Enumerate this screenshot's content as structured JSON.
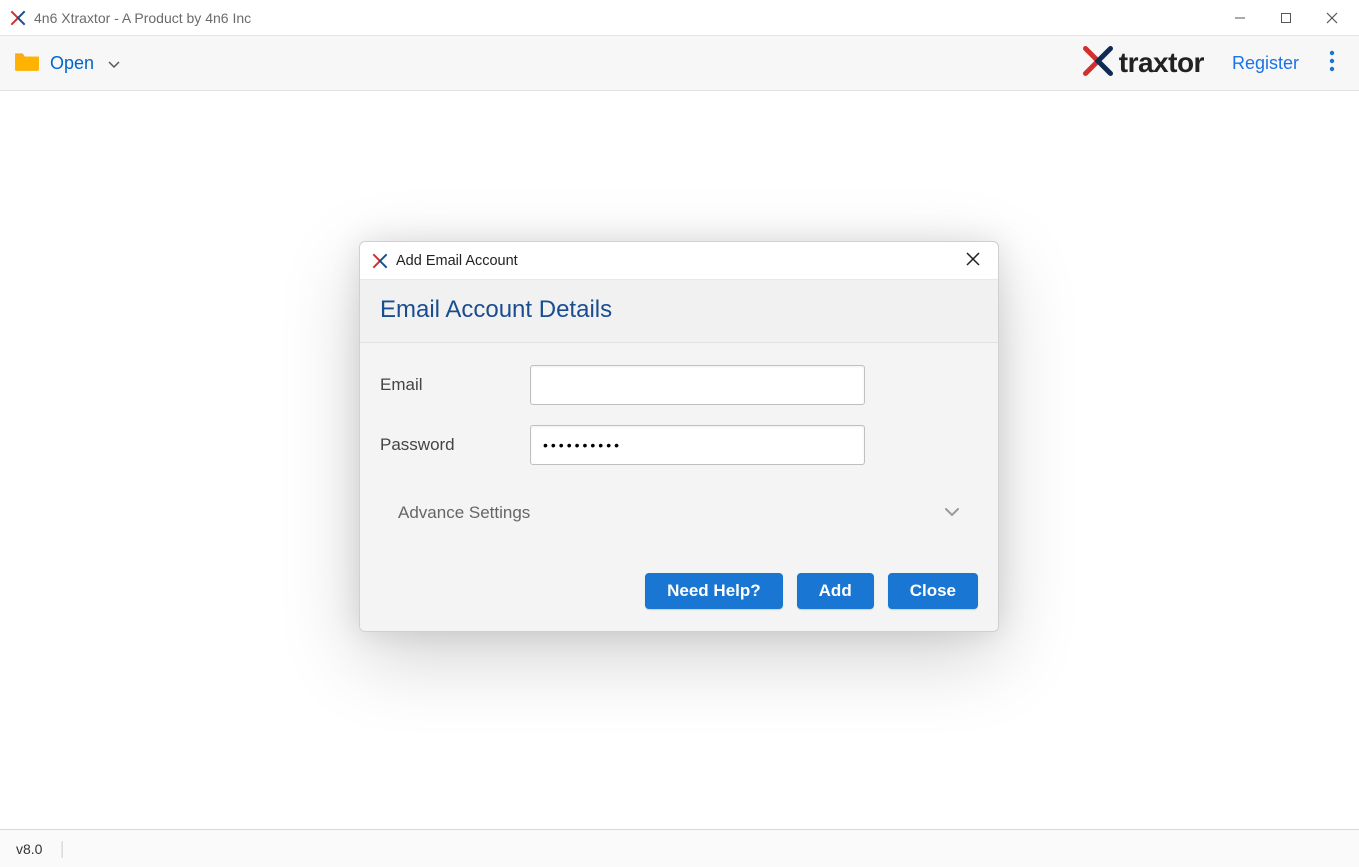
{
  "titlebar": {
    "title": "4n6 Xtraxtor - A Product by 4n6 Inc"
  },
  "toolbar": {
    "open_label": "Open",
    "logo_text": "traxtor",
    "register_label": "Register"
  },
  "dialog": {
    "title": "Add Email Account",
    "heading": "Email Account Details",
    "email_label": "Email",
    "email_value": "",
    "password_label": "Password",
    "password_value": "••••••••••",
    "advance_label": "Advance Settings",
    "buttons": {
      "help": "Need Help?",
      "add": "Add",
      "close": "Close"
    }
  },
  "status": {
    "version": "v8.0"
  }
}
